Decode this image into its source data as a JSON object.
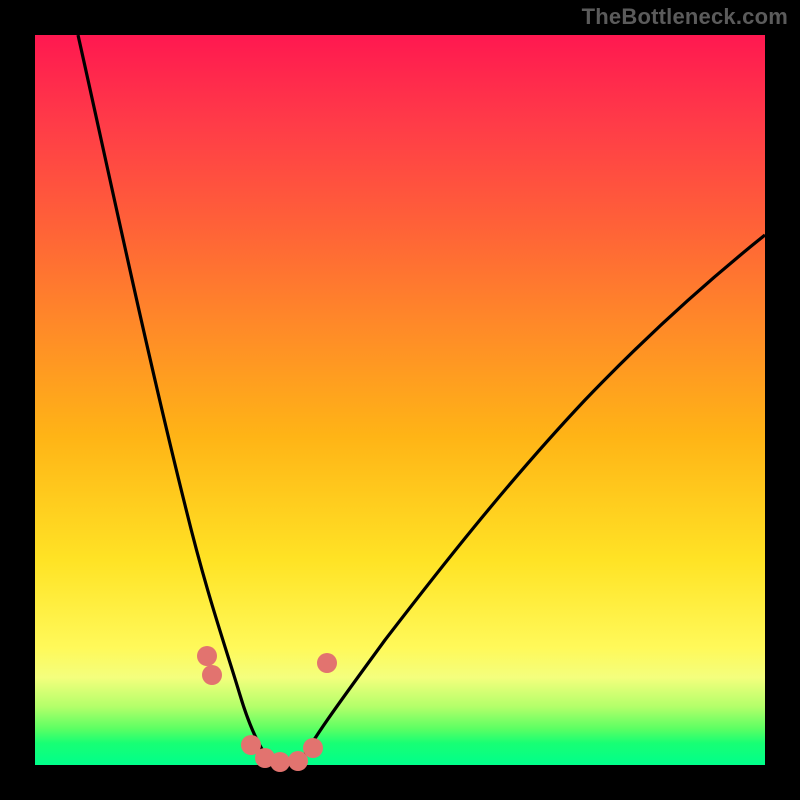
{
  "watermark": "TheBottleneck.com",
  "colors": {
    "background": "#000000",
    "curve": "#000000",
    "marker": "#e2736f",
    "gradient_stops": [
      "#ff1850",
      "#ff3b48",
      "#ff6138",
      "#ff8a28",
      "#ffb416",
      "#ffe325",
      "#fff95a",
      "#f4ff7d",
      "#b3ff6a",
      "#5dff63",
      "#18ff74",
      "#00ff8a"
    ]
  },
  "chart_data": {
    "type": "line",
    "title": "",
    "xlabel": "",
    "ylabel": "",
    "xlim": [
      0,
      100
    ],
    "ylim": [
      0,
      100
    ],
    "series": [
      {
        "name": "left-curve",
        "x": [
          6,
          8,
          10,
          12,
          14,
          16,
          18,
          20,
          22,
          23.5,
          25,
          27,
          29,
          31,
          32.5
        ],
        "y": [
          100,
          88,
          76,
          64,
          53,
          43,
          34,
          26,
          19,
          15,
          11,
          6.5,
          3.3,
          1.2,
          0
        ]
      },
      {
        "name": "right-curve",
        "x": [
          36,
          38,
          41,
          45,
          50,
          56,
          63,
          71,
          80,
          90,
          100
        ],
        "y": [
          0,
          2.3,
          6.2,
          12,
          19.5,
          28,
          37,
          46.5,
          56,
          65,
          73
        ]
      }
    ],
    "markers": [
      {
        "name": "left-marker-upper",
        "x": 23.5,
        "y": 15
      },
      {
        "name": "left-marker-lower",
        "x": 24.2,
        "y": 12
      },
      {
        "name": "bottom-marker-1",
        "x": 29.5,
        "y": 2.8
      },
      {
        "name": "bottom-marker-2",
        "x": 31.5,
        "y": 0.9
      },
      {
        "name": "bottom-marker-3",
        "x": 33.5,
        "y": 0.4
      },
      {
        "name": "bottom-marker-4",
        "x": 36.0,
        "y": 0.5
      },
      {
        "name": "bottom-marker-5",
        "x": 38.0,
        "y": 2.3
      },
      {
        "name": "right-marker-upper",
        "x": 40.0,
        "y": 14
      }
    ],
    "marker_color": "#e2736f",
    "marker_radius_px": 10
  }
}
